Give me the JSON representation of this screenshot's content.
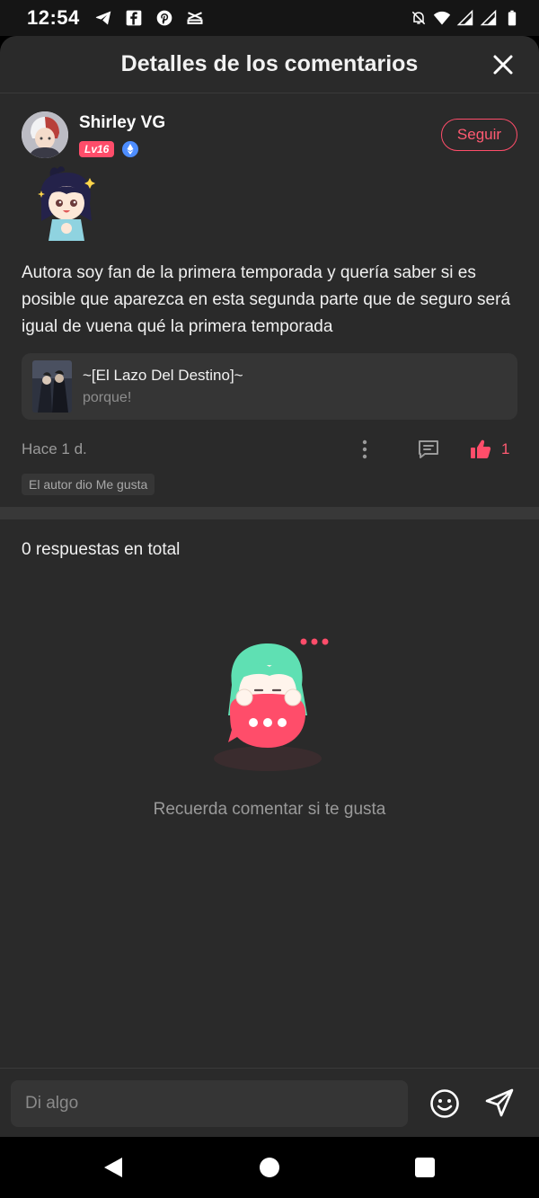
{
  "status_bar": {
    "time": "12:54",
    "left_icons": [
      "telegram-icon",
      "facebook-icon",
      "pinterest-icon",
      "capcut-icon"
    ],
    "right_icons": [
      "mute-icon",
      "wifi-icon",
      "signal-icon",
      "signal-icon",
      "battery-icon"
    ]
  },
  "header": {
    "title": "Detalles de los comentarios",
    "close_icon": "close-icon"
  },
  "comment": {
    "username": "Shirley VG",
    "level_badge": "Lv16",
    "follow_label": "Seguir",
    "text": "Autora soy fan de la primera temporada y quería saber si es posible que aparezca en esta segunda parte que de seguro será igual de vuena qué la primera temporada",
    "book": {
      "title": "~[El Lazo Del Destino]~",
      "subtitle": "porque!"
    },
    "time_ago": "Hace 1 d.",
    "like_count": "1",
    "author_liked": "El autor dio Me gusta"
  },
  "replies": {
    "count_label": "0 respuestas en total",
    "empty_text": "Recuerda comentar si te gusta"
  },
  "input": {
    "placeholder": "Di algo"
  },
  "colors": {
    "accent": "#ff4d6a",
    "background": "#2a2a2a",
    "card": "#353535"
  }
}
